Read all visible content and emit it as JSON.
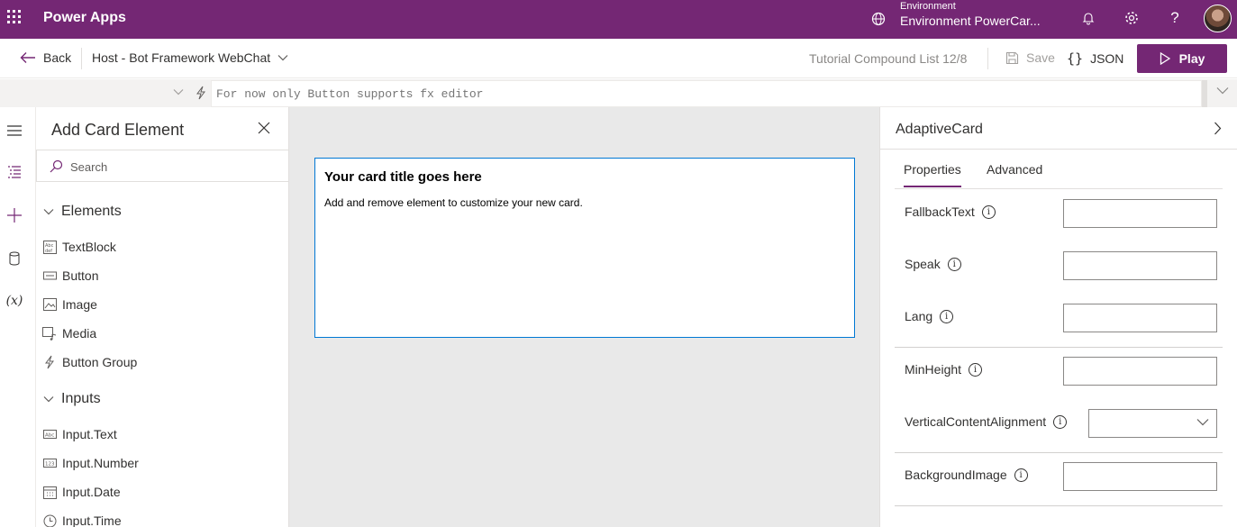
{
  "app": {
    "title": "Power Apps"
  },
  "environment": {
    "label": "Environment",
    "name": "Environment PowerCar..."
  },
  "command_bar": {
    "back_label": "Back",
    "host_select": "Host - Bot Framework WebChat",
    "tutorial": "Tutorial Compound List 12/8",
    "save_label": "Save",
    "json_label": "JSON",
    "play_label": "Play"
  },
  "formula_bar": {
    "placeholder": "For now only Button supports fx editor"
  },
  "insert_panel": {
    "title": "Add Card Element",
    "search_placeholder": "Search",
    "groups": [
      {
        "label": "Elements",
        "items": [
          {
            "label": "TextBlock",
            "icon": "textblock-icon"
          },
          {
            "label": "Button",
            "icon": "button-icon"
          },
          {
            "label": "Image",
            "icon": "image-icon"
          },
          {
            "label": "Media",
            "icon": "media-icon"
          },
          {
            "label": "Button Group",
            "icon": "lightning-icon"
          }
        ]
      },
      {
        "label": "Inputs",
        "items": [
          {
            "label": "Input.Text",
            "icon": "input-text-icon"
          },
          {
            "label": "Input.Number",
            "icon": "input-number-icon"
          },
          {
            "label": "Input.Date",
            "icon": "calendar-icon"
          },
          {
            "label": "Input.Time",
            "icon": "clock-icon"
          }
        ]
      }
    ]
  },
  "card": {
    "title": "Your card title goes here",
    "body": "Add and remove element to customize your new card."
  },
  "properties": {
    "title": "AdaptiveCard",
    "tabs": [
      "Properties",
      "Advanced"
    ],
    "active_tab": "Properties",
    "fields": [
      {
        "label": "FallbackText",
        "value": ""
      },
      {
        "label": "Speak",
        "value": ""
      },
      {
        "label": "Lang",
        "value": ""
      },
      {
        "label": "MinHeight",
        "value": ""
      },
      {
        "label": "VerticalContentAlignment",
        "value": ""
      },
      {
        "label": "BackgroundImage",
        "value": ""
      }
    ]
  },
  "colors": {
    "brand": "#742774",
    "accent": "#0078d4",
    "canvas": "#e9e9e9"
  }
}
